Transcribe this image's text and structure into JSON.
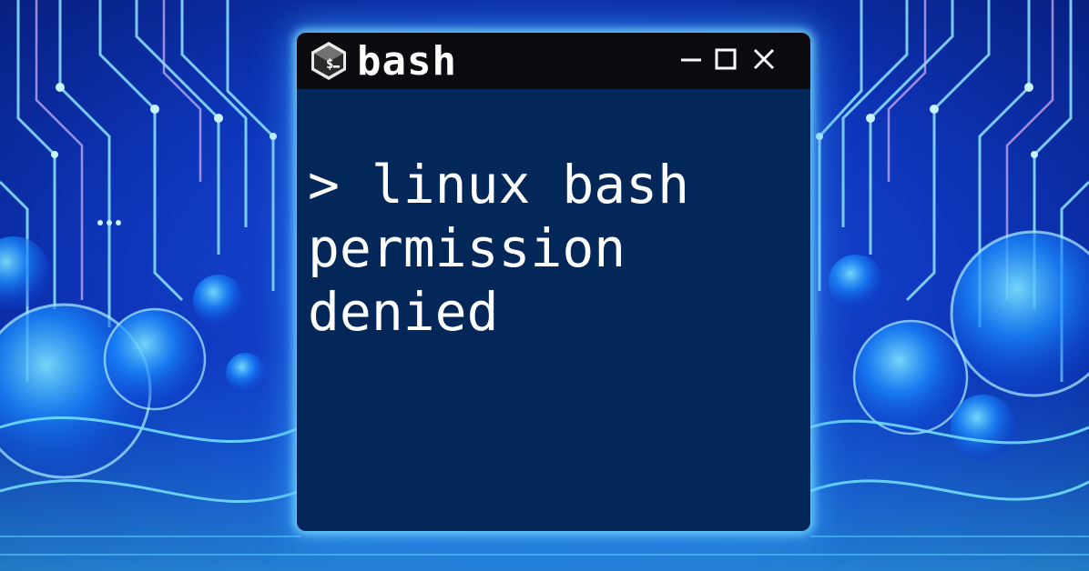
{
  "window": {
    "title": "bash",
    "icon": "terminal-icon",
    "controls": [
      "minimize-icon",
      "maximize-icon",
      "close-icon"
    ]
  },
  "terminal": {
    "text": "> linux bash permission denied"
  },
  "colors": {
    "background": "#0a2a8f",
    "glow": "#5ad2ff",
    "title_bar": "#0b0b0f",
    "terminal_bg": "#04275a",
    "text": "#ffffff"
  }
}
